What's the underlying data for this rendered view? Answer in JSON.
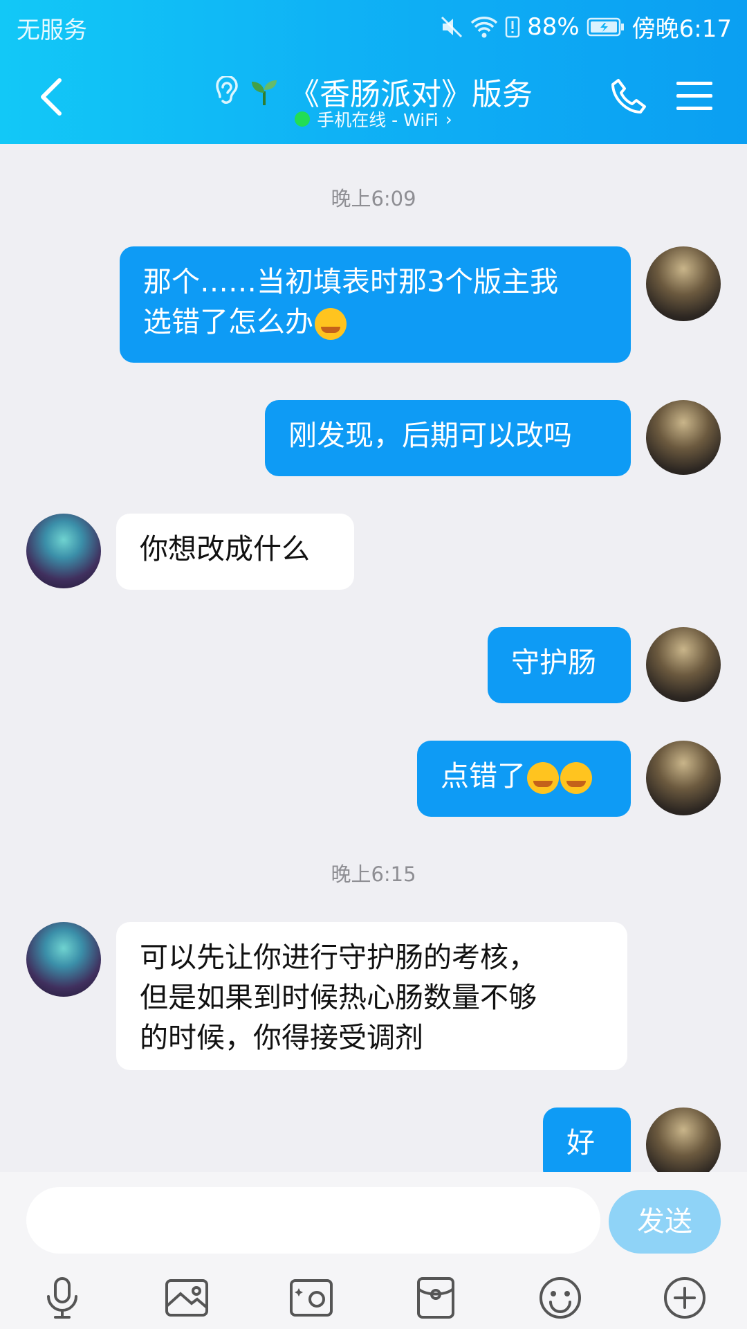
{
  "status": {
    "carrier": "无服务",
    "battery": "88%",
    "time": "傍晚6:17"
  },
  "header": {
    "title": "《香肠派对》版务",
    "subtitle": "手机在线 - WiFi",
    "chevron": "›"
  },
  "icons": [
    "back-icon",
    "ear-icon",
    "sprout-icon",
    "phone-icon",
    "menu-icon",
    "mute-icon",
    "wifi-icon",
    "battery-icon",
    "mic-icon",
    "image-icon",
    "camera-icon",
    "redpacket-icon",
    "emoji-icon",
    "plus-icon"
  ],
  "chat": {
    "time1": "晚上6:09",
    "time2": "晚上6:15",
    "m1": "那个……当初填表时那3个版主我\n选错了怎么办",
    "m2": "刚发现，后期可以改吗",
    "m3": "你想改成什么",
    "m4": "守护肠",
    "m5": "点错了",
    "m6": "可以先让你进行守护肠的考核，\n但是如果到时候热心肠数量不够\n的时候，你得接受调剂",
    "m7": "好"
  },
  "input": {
    "placeholder": "",
    "send_label": "发送"
  },
  "colors": {
    "header": "#0fb2f5",
    "bubble_out": "#0e9bf5",
    "bubble_in": "#ffffff",
    "send_disabled": "#8fd3f7"
  }
}
